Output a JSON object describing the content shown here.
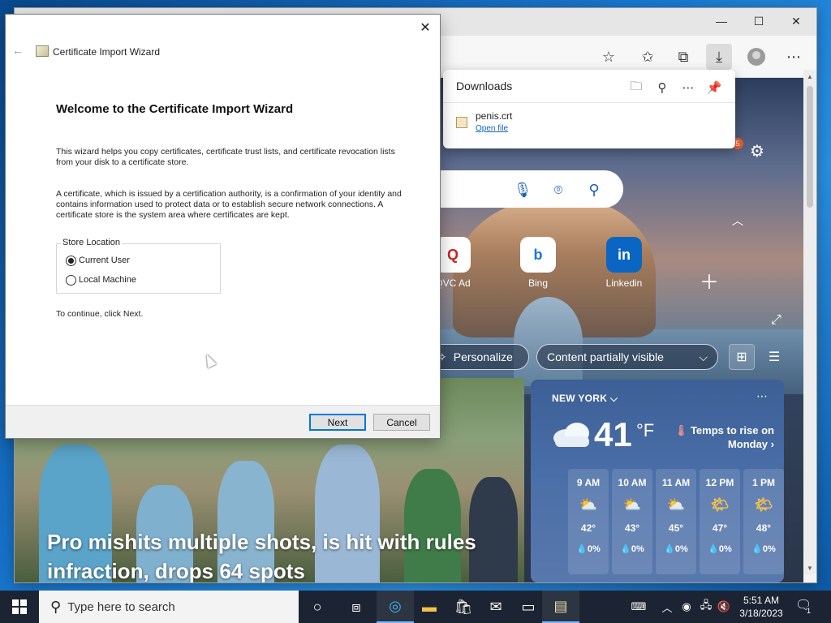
{
  "edge": {
    "window_controls": {
      "minimize": "—",
      "maximize": "☐",
      "close": "✕"
    },
    "toolbar": {
      "favorites_add_icon": "star-plus-icon",
      "favorites_icon": "favorites-icon",
      "collections_icon": "collections-icon",
      "downloads_icon": "download-icon",
      "profile_icon": "profile-icon",
      "menu": "⋯"
    },
    "downloads": {
      "title": "Downloads",
      "icons": [
        "folder-icon",
        "search-icon",
        "more-icon",
        "pin-icon"
      ],
      "items": [
        {
          "name": "penis.crt",
          "action": "Open file"
        }
      ]
    },
    "new_tab": {
      "notification_count": "5",
      "quick_links": [
        {
          "label": "QVC Ad",
          "glyph": "Q"
        },
        {
          "label": "Bing",
          "glyph": "b"
        },
        {
          "label": "Linkedin",
          "glyph": "in"
        }
      ],
      "personalize": "Personalize",
      "content_visibility": "Content partially visible",
      "headline": "Pro mishits multiple shots, is hit with rules infraction, drops 64 spots",
      "weather": {
        "location": "NEW YORK",
        "temp": "41",
        "unit": "°F",
        "note": "Temps to rise on Monday",
        "hours": [
          {
            "time": "9 AM",
            "temp": "42°",
            "precip": "0%"
          },
          {
            "time": "10 AM",
            "temp": "43°",
            "precip": "0%"
          },
          {
            "time": "11 AM",
            "temp": "45°",
            "precip": "0%"
          },
          {
            "time": "12 PM",
            "temp": "47°",
            "precip": "0%"
          },
          {
            "time": "1 PM",
            "temp": "48°",
            "precip": "0%"
          }
        ]
      }
    }
  },
  "wizard": {
    "app_title": "Certificate Import Wizard",
    "heading": "Welcome to the Certificate Import Wizard",
    "paragraph1": "This wizard helps you copy certificates, certificate trust lists, and certificate revocation lists from your disk to a certificate store.",
    "paragraph2": "A certificate, which is issued by a certification authority, is a confirmation of your identity and contains information used to protect data or to establish secure network connections. A certificate store is the system area where certificates are kept.",
    "store_location_label": "Store Location",
    "options": [
      {
        "label": "Current User",
        "selected": true
      },
      {
        "label": "Local Machine",
        "selected": false
      }
    ],
    "continue_text": "To continue, click Next.",
    "next": "Next",
    "cancel": "Cancel"
  },
  "taskbar": {
    "search_placeholder": "Type here to search",
    "clock_time": "5:51 AM",
    "clock_date": "3/18/2023",
    "notification_count": "1"
  }
}
